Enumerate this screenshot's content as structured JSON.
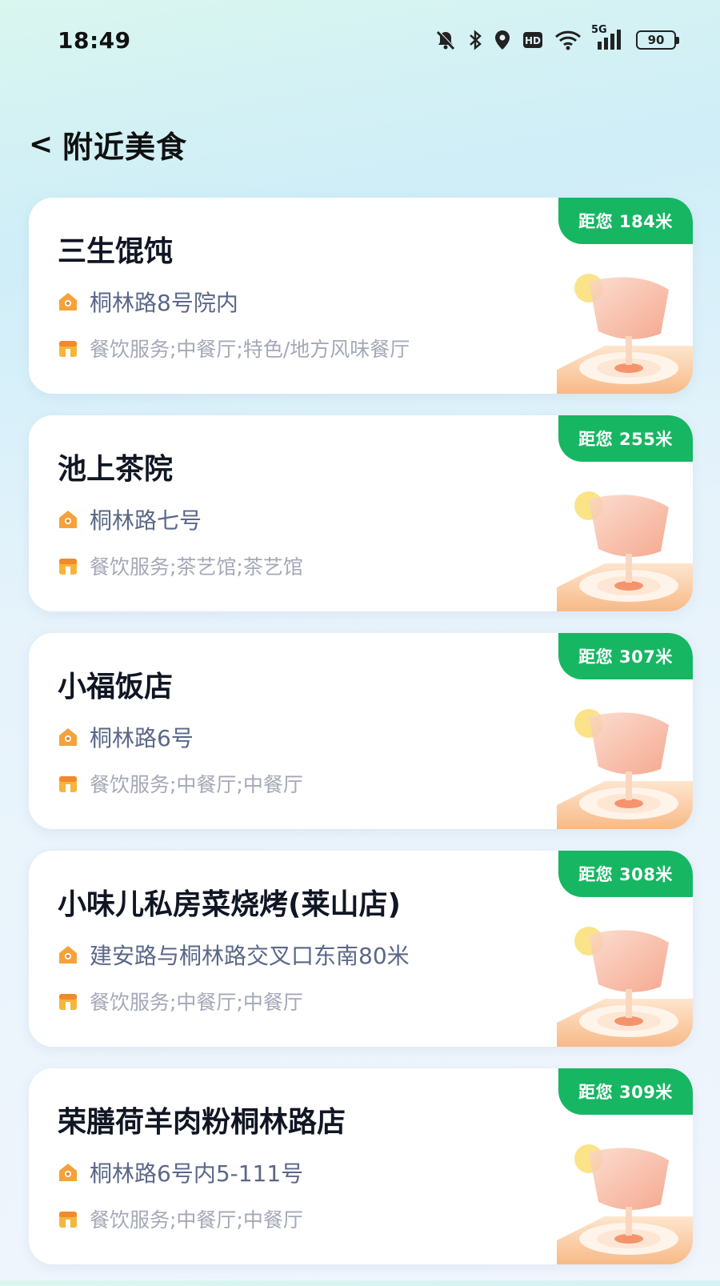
{
  "status_bar": {
    "time": "18:49",
    "signal_label": "5G",
    "battery": "90",
    "icons": [
      "bell-off-icon",
      "bluetooth-icon",
      "location-icon",
      "hd-icon",
      "wifi-icon",
      "signal-icon",
      "battery-icon"
    ]
  },
  "header": {
    "back_label": "<",
    "title": "附近美食"
  },
  "colors": {
    "badge_green": "#17b663",
    "address_text": "#5a6787",
    "category_text": "#a4a9b7",
    "icon_orange": "#f5a23a"
  },
  "restaurants": [
    {
      "distance": "距您 184米",
      "name": "三生馄饨",
      "address": "桐林路8号院内",
      "category": "餐饮服务;中餐厅;特色/地方风味餐厅"
    },
    {
      "distance": "距您 255米",
      "name": "池上茶院",
      "address": "桐林路七号",
      "category": "餐饮服务;茶艺馆;茶艺馆"
    },
    {
      "distance": "距您 307米",
      "name": "小福饭店",
      "address": "桐林路6号",
      "category": "餐饮服务;中餐厅;中餐厅"
    },
    {
      "distance": "距您 308米",
      "name": "小味儿私房菜烧烤(莱山店)",
      "address": "建安路与桐林路交叉口东南80米",
      "category": "餐饮服务;中餐厅;中餐厅"
    },
    {
      "distance": "距您 309米",
      "name": "荣膳荷羊肉粉桐林路店",
      "address": "桐林路6号内5-111号",
      "category": "餐饮服务;中餐厅;中餐厅"
    }
  ]
}
